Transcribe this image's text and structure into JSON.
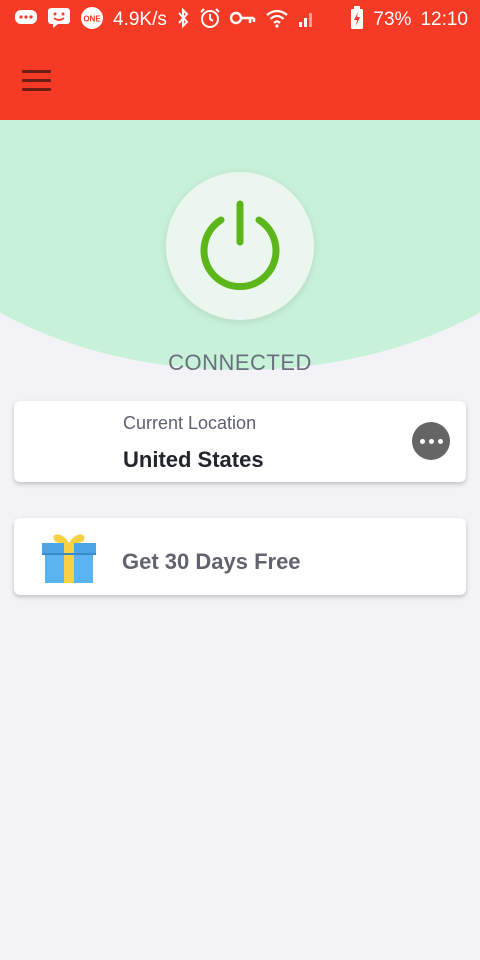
{
  "status_bar": {
    "network_speed": "4.9K/s",
    "battery": "73%",
    "time": "12:10",
    "icons": [
      "chat-bubble-icon",
      "message-icon",
      "one-icon",
      "bluetooth-icon",
      "alarm-icon",
      "key-icon",
      "wifi-icon",
      "signal-icon",
      "battery-charging-icon"
    ]
  },
  "appbar": {
    "menu_icon": "hamburger-menu-icon"
  },
  "connection": {
    "status": "CONNECTED"
  },
  "location_card": {
    "label": "Current Location",
    "value": "United States"
  },
  "promo_card": {
    "label": "Get 30 Days Free",
    "icon": "gift-icon"
  },
  "colors": {
    "header_red": "#f53b26",
    "mint_arc": "#c7f1d9",
    "power_green": "#5cb519",
    "background": "#f3f3f7"
  }
}
